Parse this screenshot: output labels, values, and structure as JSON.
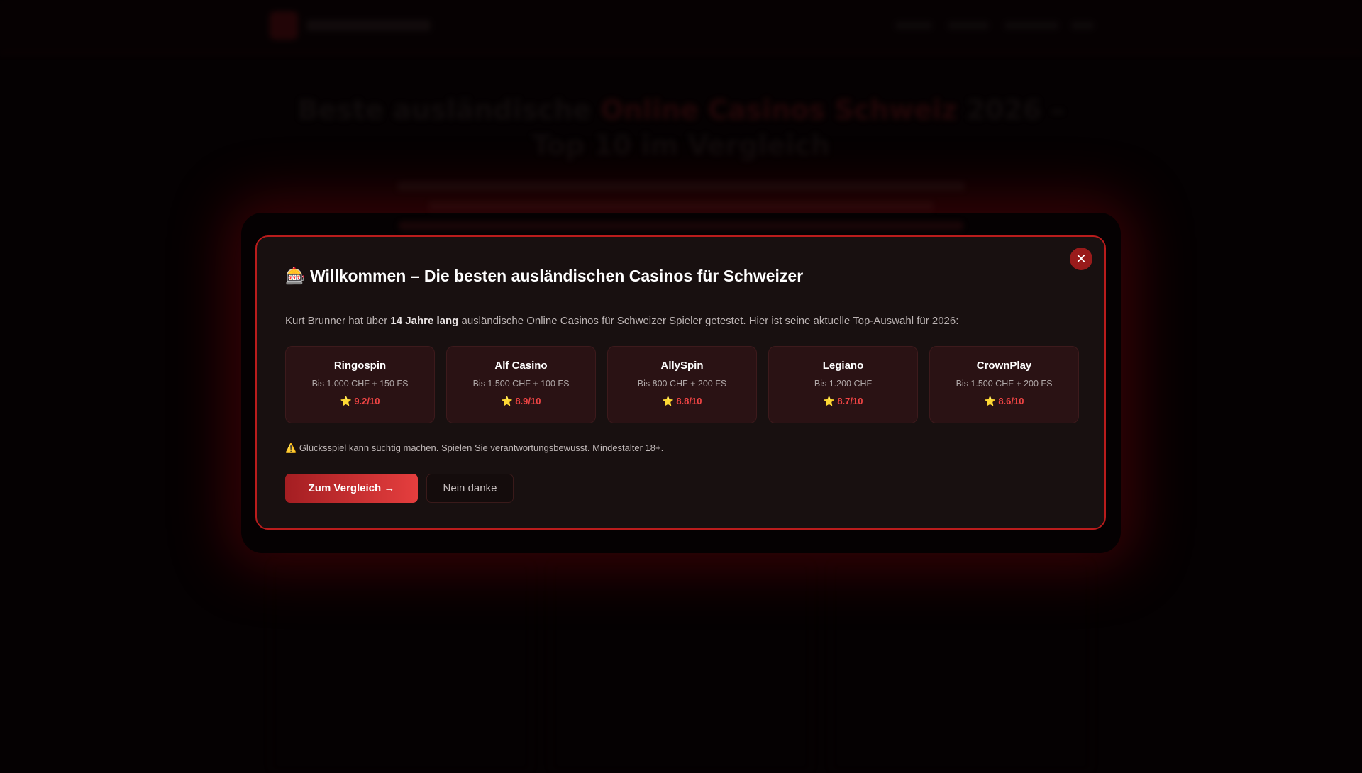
{
  "background": {
    "hero_title_pre": "Beste ausländische ",
    "hero_title_accent": "Online Casinos Schweiz",
    "hero_title_post": " 2026 – Top 10 im Vergleich"
  },
  "modal": {
    "icon": "🎰",
    "title": "Willkommen – Die besten ausländischen Casinos für Schweizer",
    "intro_pre": "Kurt Brunner hat über ",
    "intro_bold": "14 Jahre lang",
    "intro_post": " ausländische Online Casinos für Schweizer Spieler getestet. Hier ist seine aktuelle Top-Auswahl für 2026:",
    "casinos": [
      {
        "name": "Ringospin",
        "bonus": "Bis 1.000 CHF + 150 FS",
        "rating": "9.2/10"
      },
      {
        "name": "Alf Casino",
        "bonus": "Bis 1.500 CHF + 100 FS",
        "rating": "8.9/10"
      },
      {
        "name": "AllySpin",
        "bonus": "Bis 800 CHF + 200 FS",
        "rating": "8.8/10"
      },
      {
        "name": "Legiano",
        "bonus": "Bis 1.200 CHF",
        "rating": "8.7/10"
      },
      {
        "name": "CrownPlay",
        "bonus": "Bis 1.500 CHF + 200 FS",
        "rating": "8.6/10"
      }
    ],
    "star": "⭐",
    "warning_icon": "⚠️",
    "warning": "Glücksspiel kann süchtig machen. Spielen Sie verantwortungsbewusst. Mindestalter 18+.",
    "primary_label": "Zum Vergleich →",
    "secondary_label": "Nein danke",
    "close": "✕"
  },
  "colors": {
    "accent": "#b91c1c",
    "rating": "#ef4444"
  }
}
